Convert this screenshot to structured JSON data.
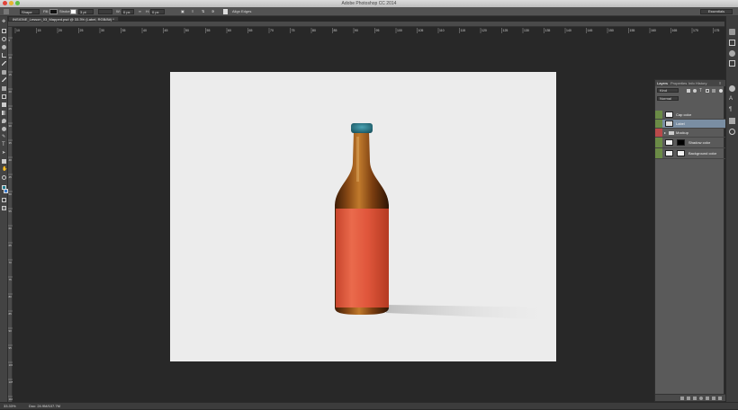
{
  "app": {
    "title": "Adobe Photoshop CC 2014"
  },
  "options_bar": {
    "tool_mode": "Shape",
    "fill_label": "Fill:",
    "stroke_label": "Stroke:",
    "stroke_width": "3 pt",
    "w_label": "W:",
    "w_value": "0 px",
    "h_label": "H:",
    "h_value": "0 px",
    "align_edges": "Align Edges",
    "workspace": "Essentials"
  },
  "document": {
    "tab_label": "INSIGNE_Lesson_03_Mapped.psd @ 33.3% (Label, RGB/8#) *"
  },
  "ruler": {
    "h_ticks": [
      "10",
      "15",
      "20",
      "25",
      "30",
      "35",
      "40",
      "45",
      "50",
      "55",
      "60",
      "65",
      "70",
      "75",
      "80",
      "85",
      "90",
      "95",
      "100",
      "105",
      "110",
      "115",
      "120",
      "125",
      "130",
      "135",
      "140",
      "145",
      "150",
      "155",
      "160",
      "165",
      "170",
      "175"
    ],
    "v_ticks": [
      "5",
      "10",
      "15",
      "20",
      "25",
      "30",
      "35",
      "40",
      "45",
      "50",
      "55",
      "60",
      "65",
      "70",
      "75",
      "80",
      "85",
      "90",
      "95",
      "100",
      "105",
      "110"
    ]
  },
  "layers_panel": {
    "tabs": [
      "Layers",
      "Properties",
      "Info",
      "History"
    ],
    "filter_kind": "Kind",
    "blend_mode": "Normal",
    "layers": [
      {
        "name": "Cap color",
        "selected": false,
        "visible": true
      },
      {
        "name": "Label",
        "selected": true,
        "visible": true
      },
      {
        "name": "Mockup",
        "selected": false,
        "visible": true,
        "group": true
      },
      {
        "name": "Shadow color",
        "selected": false,
        "visible": true
      },
      {
        "name": "Background color",
        "selected": false,
        "visible": true
      }
    ]
  },
  "status_bar": {
    "zoom": "33.33%",
    "doc_info": "Doc: 24.9M/107.7M"
  },
  "colors": {
    "workspace_bg": "#282828",
    "panel_bg": "#5a5a5a",
    "selected_layer": "#7a8ea3",
    "label_orange": "#e0563b",
    "bottle_brown": "#6b3410",
    "cap_teal": "#2a6e7e"
  }
}
